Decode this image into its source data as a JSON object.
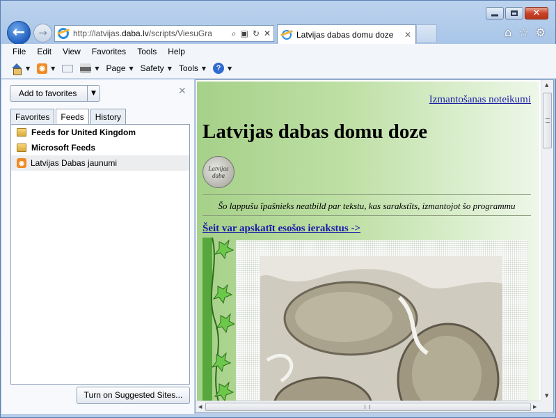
{
  "window": {
    "caption_buttons": [
      "minimize",
      "maximize",
      "close"
    ]
  },
  "nav": {
    "address_url_prefix": "http://latvijas.",
    "address_url_domain": "daba.lv",
    "address_url_suffix": "/scripts/ViesuGra",
    "tab_title": "Latvijas dabas domu doze",
    "tab_close": "✕"
  },
  "menu": {
    "items": [
      "File",
      "Edit",
      "View",
      "Favorites",
      "Tools",
      "Help"
    ]
  },
  "command_bar": {
    "page": "Page",
    "safety": "Safety",
    "tools": "Tools"
  },
  "favorites_center": {
    "add_button": "Add to favorites",
    "tabs": [
      "Favorites",
      "Feeds",
      "History"
    ],
    "active_tab": "Feeds",
    "items": [
      {
        "label": "Feeds for United Kingdom",
        "icon": "folder-icon",
        "bold": true
      },
      {
        "label": "Microsoft Feeds",
        "icon": "folder-icon",
        "bold": true
      },
      {
        "label": "Latvijas Dabas jaunumi",
        "icon": "rss-icon",
        "bold": false
      }
    ],
    "suggested_button": "Turn on Suggested Sites..."
  },
  "page": {
    "rules_link": "Izmantošanas noteikumi",
    "title": "Latvijas dabas domu doze",
    "logo_text_1": "Latvijas",
    "logo_text_2": "daba",
    "disclaimer": "Šo lappušu īpašnieks neatbild par tekstu, kas sarakstīts, izmantojot šo programmu",
    "archive_link": "Šeit var apskatīt esošos ierakstus ->"
  },
  "colors": {
    "page_gradient_left": "#a6d189",
    "link": "#1a1aa6",
    "rss": "#f08a24"
  }
}
